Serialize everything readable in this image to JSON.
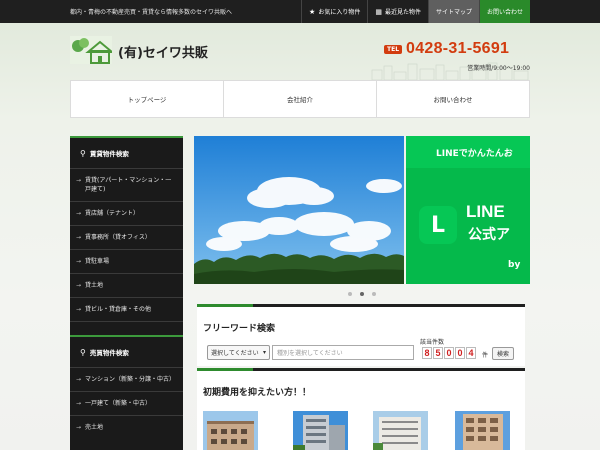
{
  "topbar": {
    "tagline": "都内・青梅の不動産売買・賃貸なら情報多数のセイワ共販へ",
    "nav": [
      {
        "label": "お気に入り物件",
        "icon": "star-icon"
      },
      {
        "label": "最近見た物件",
        "icon": "history-icon"
      },
      {
        "label": "サイトマップ"
      },
      {
        "label": "お問い合わせ"
      }
    ]
  },
  "header": {
    "company": "(有)セイワ共販",
    "tel_badge": "TEL",
    "tel": "0428-31-5691",
    "hours": "営業時間/9:00〜19:00"
  },
  "gnav": [
    "トップページ",
    "会社紹介",
    "お問い合わせ"
  ],
  "sidebar": {
    "rent_title": "賃貸物件検索",
    "rent_items": [
      "賃貸(アパート・マンション・一戸建て)",
      "賃店舗（テナント）",
      "賃事務所（貸オフィス）",
      "貸駐車場",
      "貸土地",
      "貸ビル・貸倉庫・その他"
    ],
    "sale_title": "売買物件検索",
    "sale_items": [
      "マンション（新築・分譲・中古）",
      "一戸建て（新築・中古）",
      "売土地"
    ]
  },
  "slider": {
    "line_head": "LINEでかんたんお",
    "line_big": "LINE",
    "line_sub": "公式ア",
    "line_by": "by"
  },
  "search": {
    "title": "フリーワード検索",
    "select_value": "選択してください",
    "keyword_placeholder": "種別を選択してください",
    "count_label": "該当件数",
    "count_digits": [
      "8",
      "5",
      "0",
      "0",
      "4"
    ],
    "count_unit": "件",
    "button": "検索"
  },
  "initial": {
    "title": "初期費用を抑えたい方！！"
  },
  "colors": {
    "accent_green": "#2e8b2e",
    "tel_red": "#d23c0f",
    "line_green": "#06c755"
  }
}
